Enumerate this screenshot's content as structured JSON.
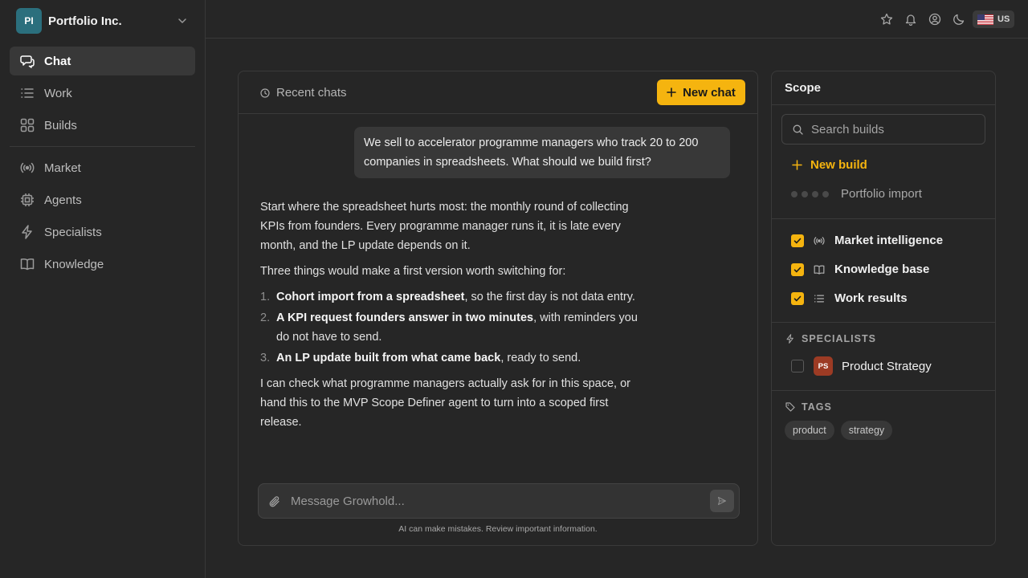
{
  "org": {
    "initials": "PI",
    "name": "Portfolio Inc."
  },
  "nav": {
    "items": [
      {
        "label": "Chat",
        "icon": "chat-icon",
        "active": true
      },
      {
        "label": "Work",
        "icon": "list-icon"
      },
      {
        "label": "Builds",
        "icon": "grid-icon"
      },
      {
        "label": "Market",
        "icon": "broadcast-icon"
      },
      {
        "label": "Agents",
        "icon": "chip-icon"
      },
      {
        "label": "Specialists",
        "icon": "bolt-icon"
      },
      {
        "label": "Knowledge",
        "icon": "book-icon"
      }
    ]
  },
  "topbar": {
    "icons": [
      "star-icon",
      "bell-icon",
      "user-circle-icon",
      "moon-icon"
    ],
    "locale": "US"
  },
  "chat": {
    "recent_label": "Recent chats",
    "new_chat_label": "New chat",
    "user_message": "We sell to accelerator programme managers who track 20 to 200 companies in spreadsheets. What should we build first?",
    "assistant": {
      "intro": "Start where the spreadsheet hurts most: the monthly round of collecting KPIs from founders. Every programme manager runs it, it is late every month, and the LP update depends on it.",
      "lead": "Three things would make a first version worth switching for:",
      "items": [
        {
          "num": "1.",
          "bold": "Cohort import from a spreadsheet",
          "rest": ", so the first day is not data entry."
        },
        {
          "num": "2.",
          "bold": "A KPI request founders answer in two minutes",
          "rest": ", with reminders you do not have to send."
        },
        {
          "num": "3.",
          "bold": "An LP update built from what came back",
          "rest": ", ready to send."
        }
      ],
      "outro": "I can check what programme managers actually ask for in this space, or hand this to the MVP Scope Definer agent to turn into a scoped first release."
    },
    "composer_placeholder": "Message Growhold...",
    "disclaimer": "AI can make mistakes. Review important information."
  },
  "scope": {
    "title": "Scope",
    "search_placeholder": "Search builds",
    "new_build_label": "New build",
    "pending_build": "Portfolio import",
    "sources": [
      {
        "label": "Market intelligence",
        "checked": true,
        "icon": "broadcast-icon"
      },
      {
        "label": "Knowledge base",
        "checked": true,
        "icon": "book-icon"
      },
      {
        "label": "Work results",
        "checked": true,
        "icon": "list-icon"
      }
    ],
    "specialists_heading": "SPECIALISTS",
    "specialist": {
      "initials": "PS",
      "name": "Product Strategy",
      "checked": false
    },
    "tags_heading": "TAGS",
    "tags": [
      "product",
      "strategy"
    ]
  },
  "colors": {
    "accent": "#f5b40f",
    "org_avatar": "#2b6f7d",
    "specialist_avatar": "#9c3b24"
  }
}
